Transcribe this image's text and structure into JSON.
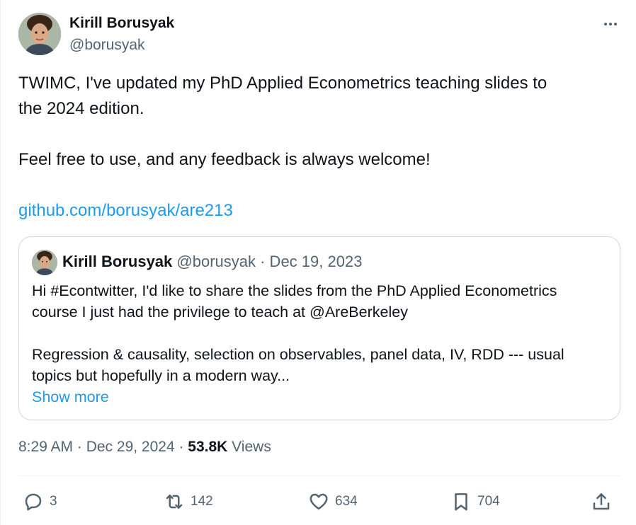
{
  "tweet": {
    "author": {
      "name": "Kirill Borusyak",
      "handle": "@borusyak"
    },
    "text_lines": [
      "TWIMC, I've updated my PhD Applied Econometrics teaching slides to",
      "the 2024 edition.",
      "Feel free to use, and any feedback is always welcome!"
    ],
    "link": "github.com/borusyak/are213",
    "quote": {
      "author_name": "Kirill Borusyak",
      "meta": "@borusyak · Dec 19, 2023",
      "lines": [
        "Hi #Econtwitter, I'd like to share the slides from the PhD Applied Econometrics",
        "course I just had the privilege to teach at @AreBerkeley",
        "Regression & causality, selection on observables, panel data, IV, RDD --- usual",
        "topics but hopefully in a modern way..."
      ],
      "show_more": "Show more"
    },
    "timestamp": "8:29 AM · Dec 29, 2024 · ",
    "views_count": "53.8K",
    "views_label": " Views"
  },
  "actions": {
    "replies": "3",
    "reposts": "142",
    "likes": "634",
    "bookmarks": "704"
  },
  "icons": {
    "more": "more-horizontal-icon",
    "reply": "reply-icon",
    "repost": "repost-icon",
    "like": "heart-icon",
    "bookmark": "bookmark-icon",
    "share": "share-icon"
  },
  "colors": {
    "link": "#1d9bf0",
    "secondary_text": "#536471",
    "primary_text": "#0f1419",
    "border": "#cfd9de"
  }
}
